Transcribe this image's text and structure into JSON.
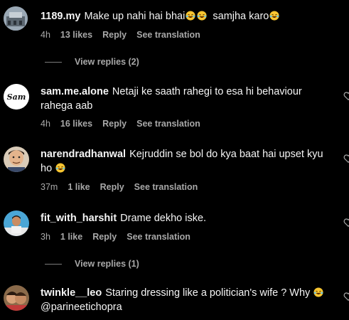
{
  "comments": [
    {
      "username": "1189.my",
      "text": "Make up nahi hai bhai",
      "text_suffix": "samjha karo",
      "time": "4h",
      "likes": "13 likes",
      "reply": "Reply",
      "translate": "See translation",
      "view_replies": "View replies (2)"
    },
    {
      "username": "sam.me.alone",
      "text": "Netaji ke saath rahegi to esa hi behaviour",
      "text_line2": "rahega aab",
      "avatar_text": "Sam",
      "time": "4h",
      "likes": "16 likes",
      "reply": "Reply",
      "translate": "See translation"
    },
    {
      "username": "narendradhanwal",
      "text": "Kejruddin se bol do kya baat hai upset kyu",
      "text_line2": "ho",
      "time": "37m",
      "likes": "1 like",
      "reply": "Reply",
      "translate": "See translation"
    },
    {
      "username": "fit_with_harshit",
      "text": "Drame dekho iske.",
      "time": "3h",
      "likes": "1 like",
      "reply": "Reply",
      "translate": "See translation",
      "view_replies": "View replies (1)"
    },
    {
      "username": "twinkle__leo",
      "text": "Staring dressing like a politician's wife ? Why",
      "text_line2": "@parineetichopra"
    }
  ],
  "colors": {
    "background": "#000000",
    "text": "#f5f5f5",
    "muted": "#a8a8a8"
  },
  "icons": {
    "emoji": "laughing-emoji-icon",
    "like": "heart-icon"
  }
}
